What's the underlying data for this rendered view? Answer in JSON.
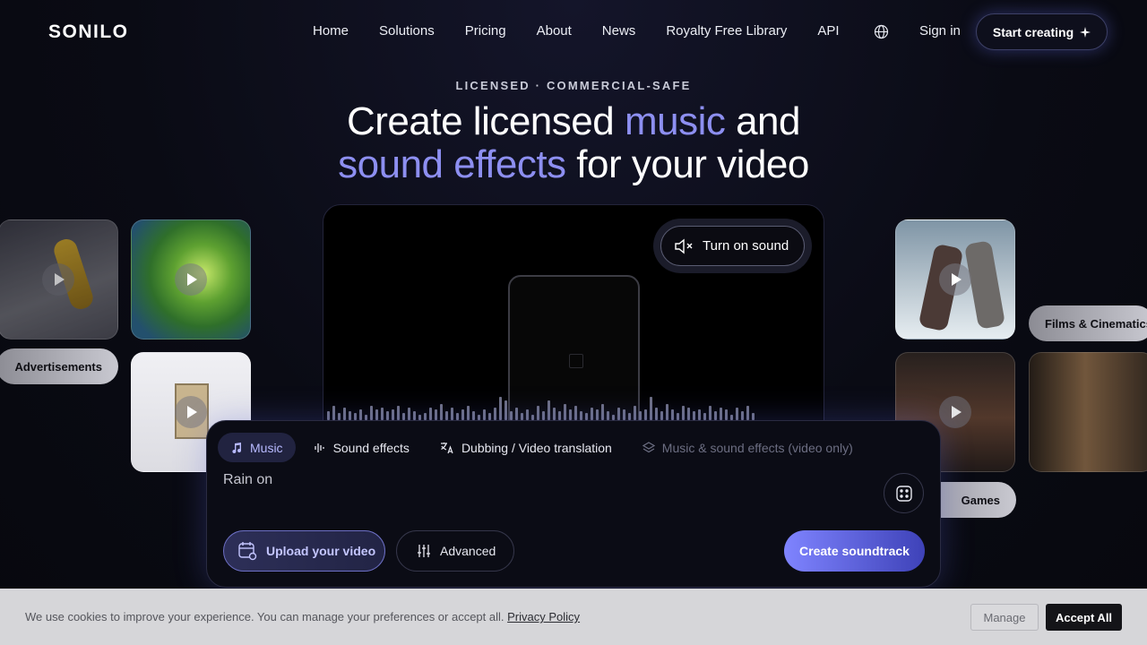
{
  "brand": {
    "logo": "SONILO"
  },
  "nav": {
    "links": [
      "Home",
      "Solutions",
      "Pricing",
      "About",
      "News",
      "Royalty Free Library",
      "API"
    ],
    "signin": "Sign in",
    "cta": "Start creating"
  },
  "hero": {
    "eyebrow": "LICENSED · COMMERCIAL-SAFE",
    "line1_a": "Create licensed ",
    "line1_accent": "music",
    "line1_b": " and",
    "line2_accent": "sound effects",
    "line2_b": " for your video"
  },
  "categories": {
    "advertisements": "Advertisements",
    "films": "Films & Cinematics",
    "games": "Games"
  },
  "video": {
    "sound_button": "Turn on sound"
  },
  "composer": {
    "tabs": [
      {
        "label": "Music",
        "icon": "music-note-icon",
        "state": "active"
      },
      {
        "label": "Sound effects",
        "icon": "waveform-icon",
        "state": "default"
      },
      {
        "label": "Dubbing / Video translation",
        "icon": "translate-icon",
        "state": "default"
      },
      {
        "label": "Music & sound effects (video only)",
        "icon": "layers-icon",
        "state": "disabled"
      }
    ],
    "prompt_value": "Rain on",
    "upload_label": "Upload your video",
    "advanced_label": "Advanced",
    "create_label": "Create soundtrack"
  },
  "cookie": {
    "text": "We use cookies to improve your experience. You can manage your preferences or accept all.",
    "policy_link": "Privacy Policy",
    "manage": "Manage",
    "accept": "Accept All"
  },
  "colors": {
    "accent": "#8d8ff1",
    "background": "#0a0b14",
    "cta_gradient_start": "#7f84ff",
    "cta_gradient_end": "#3e42b8",
    "cookie_bar": "#d6d6d9"
  }
}
